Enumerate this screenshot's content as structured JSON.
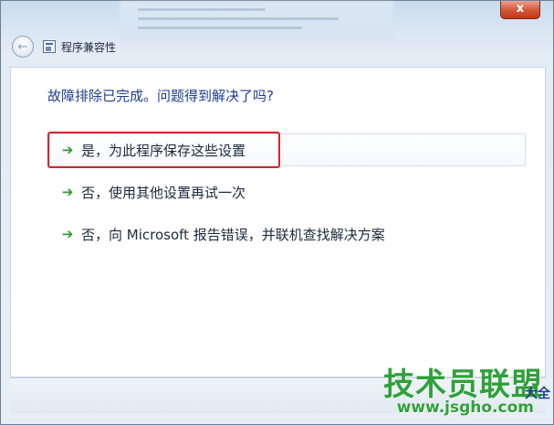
{
  "window": {
    "title": "程序兼容性",
    "close_label": "x"
  },
  "main": {
    "question": "故障排除已完成。问题得到解决了吗?",
    "options": [
      {
        "label": "是，为此程序保存这些设置"
      },
      {
        "label": "否，使用其他设置再试一次"
      },
      {
        "label": "否，向 Microsoft 报告错误，并联机查找解决方案"
      }
    ]
  },
  "watermark": {
    "brand": "技术员联盟",
    "url": "www.jsgho.com",
    "sub": "大全"
  },
  "colors": {
    "question_text": "#1e3d8f",
    "arrow": "#2c9a2c",
    "highlight": "#d8232a",
    "watermark": "#2fa13a"
  },
  "icons": {
    "back": "back-arrow-icon",
    "app": "program-compatibility-icon",
    "option_arrow": "green-arrow-icon"
  }
}
